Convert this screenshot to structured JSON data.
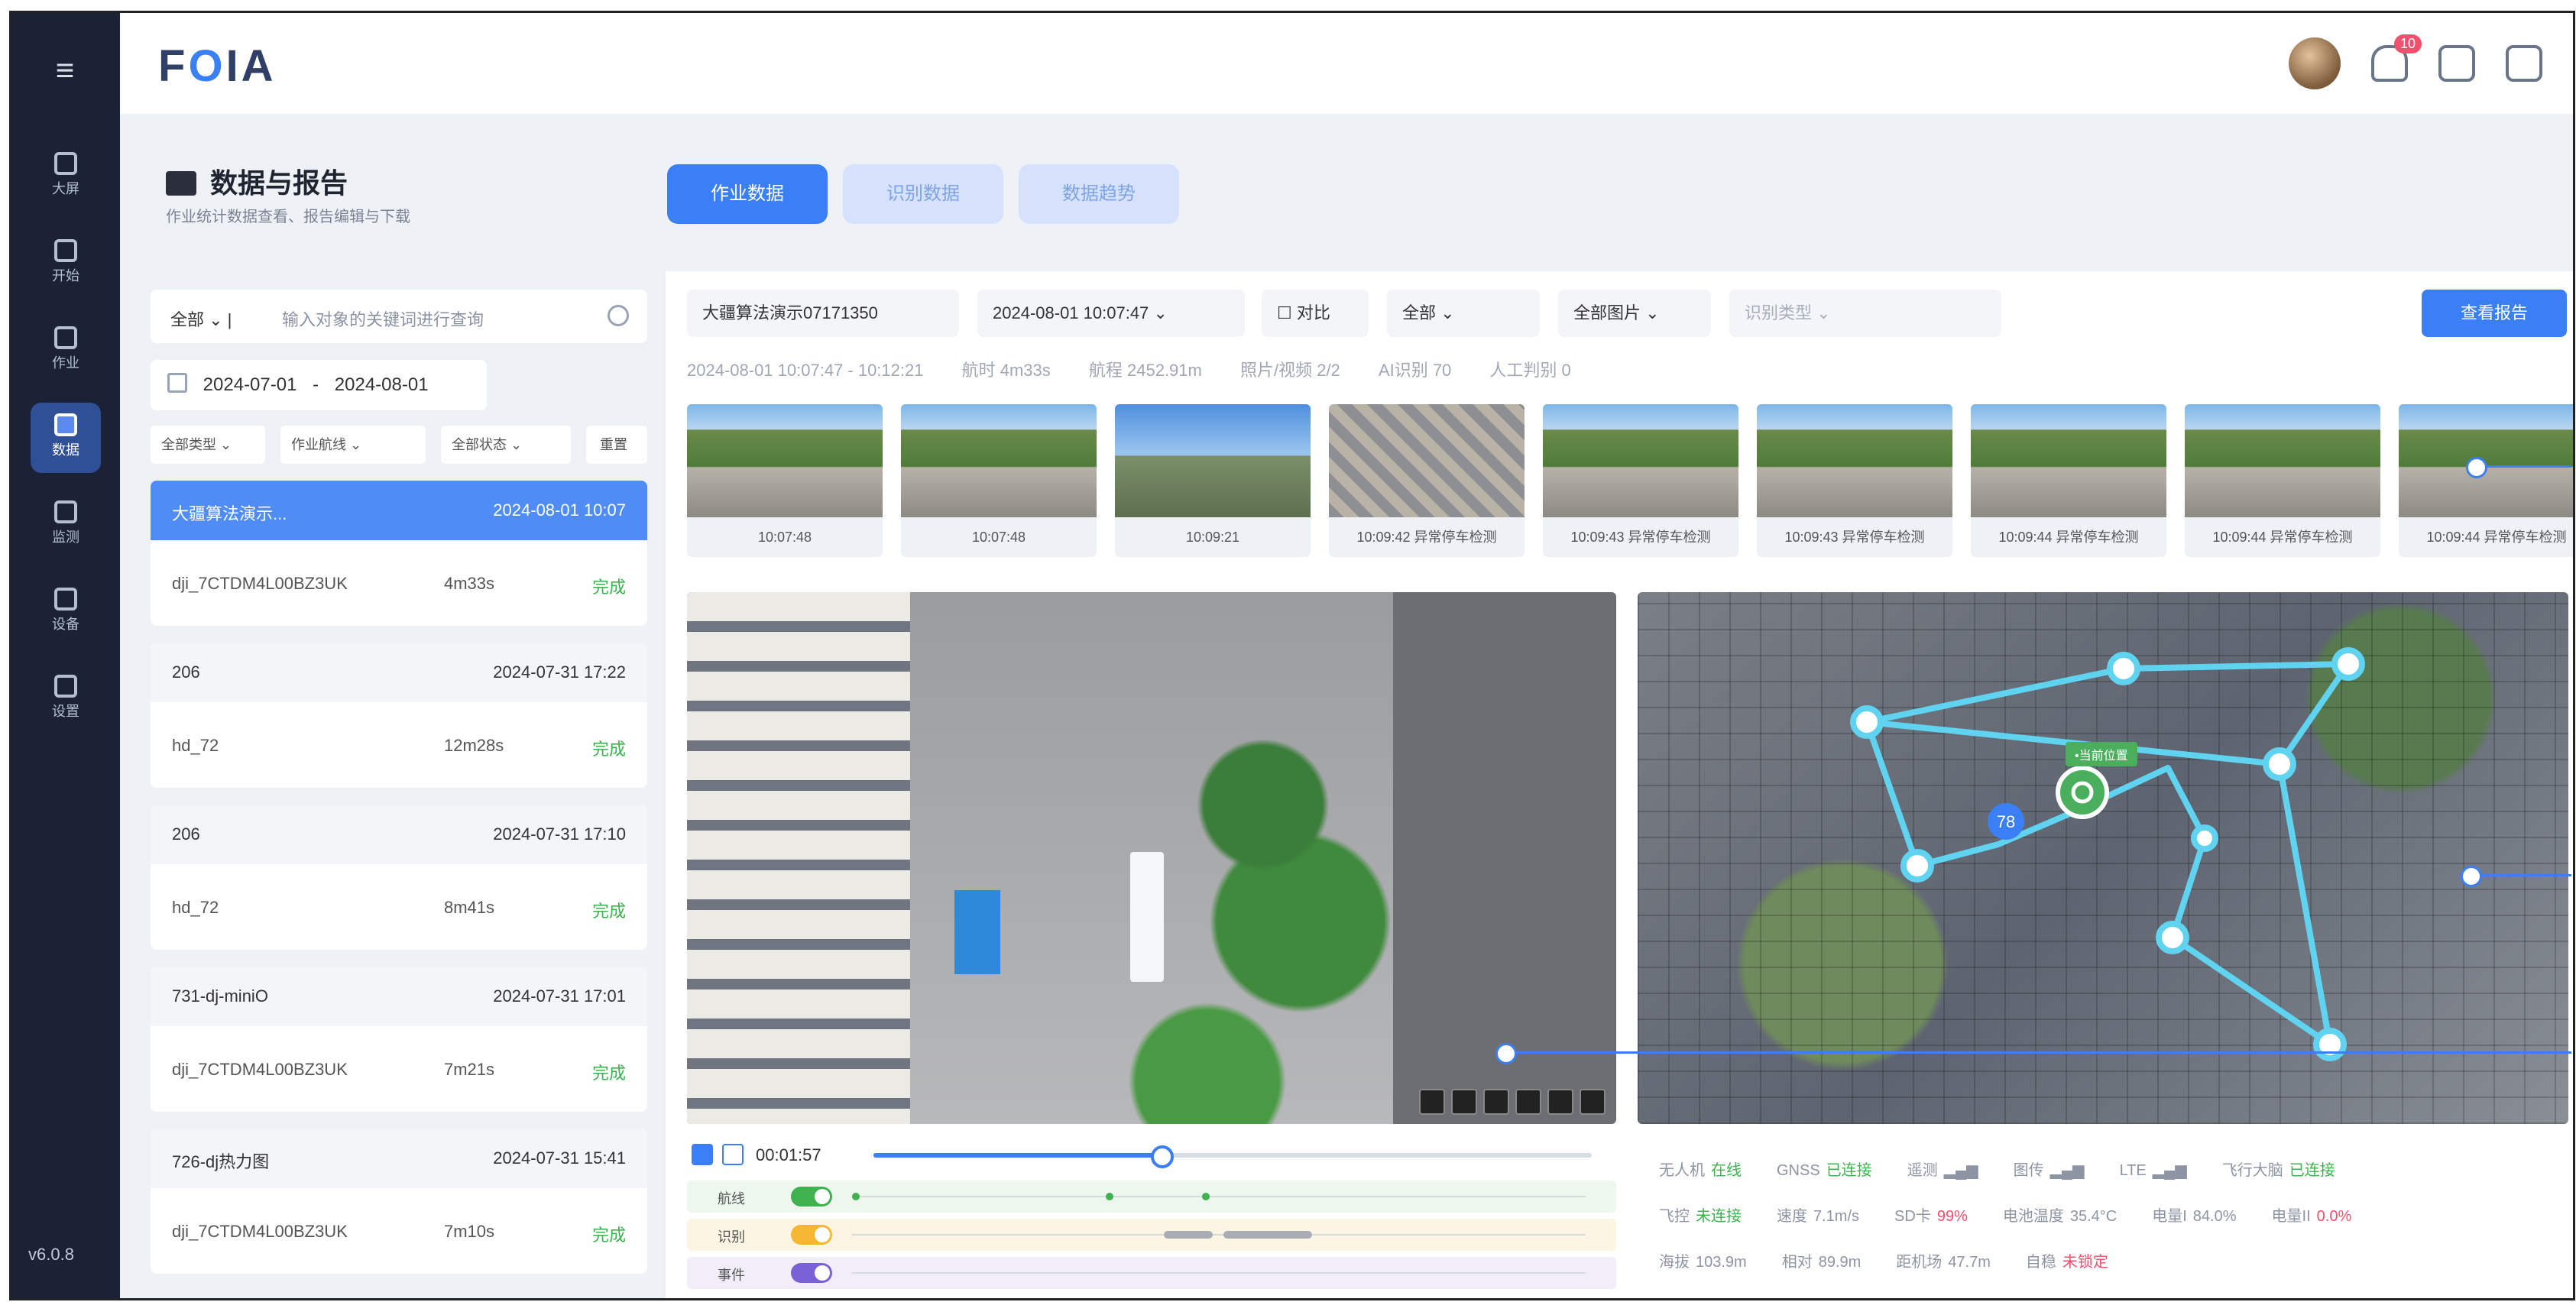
{
  "app": {
    "logo": "FOIA",
    "version": "v6.0.8",
    "notification_count": "10"
  },
  "rail": {
    "items": [
      {
        "label": "大屏",
        "icon": "monitor-icon"
      },
      {
        "label": "开始",
        "icon": "dashboard-icon"
      },
      {
        "label": "作业",
        "icon": "task-icon"
      },
      {
        "label": "数据",
        "icon": "chart-icon",
        "active": true
      },
      {
        "label": "监测",
        "icon": "eye-icon"
      },
      {
        "label": "设备",
        "icon": "device-icon"
      },
      {
        "label": "设置",
        "icon": "gear-icon"
      }
    ]
  },
  "header": {
    "title": "数据与报告",
    "subtitle": "作业统计数据查看、报告编辑与下载",
    "tabs": [
      "作业数据",
      "识别数据",
      "数据趋势"
    ]
  },
  "left": {
    "search": {
      "scope": "全部",
      "placeholder": "输入对象的关键词进行查询"
    },
    "date_range": {
      "start": "2024-07-01",
      "sep": "-",
      "end": "2024-08-01"
    },
    "filters": [
      "全部类型",
      "作业航线",
      "全部状态",
      "重置"
    ],
    "items": [
      {
        "name": "大疆算法演示...",
        "time": "2024-08-01 10:07",
        "device": "dji_7CTDM4L00BZ3UK",
        "duration": "4m33s",
        "status": "完成"
      },
      {
        "name": "206",
        "time": "2024-07-31 17:22",
        "device": "hd_72",
        "duration": "12m28s",
        "status": "完成"
      },
      {
        "name": "206",
        "time": "2024-07-31 17:10",
        "device": "hd_72",
        "duration": "8m41s",
        "status": "完成"
      },
      {
        "name": "731-dj-miniO",
        "time": "2024-07-31 17:01",
        "device": "dji_7CTDM4L00BZ3UK",
        "duration": "7m21s",
        "status": "完成"
      },
      {
        "name": "726-dj热力图",
        "time": "2024-07-31 15:41",
        "device": "dji_7CTDM4L00BZ3UK",
        "duration": "7m10s",
        "status": "完成"
      }
    ]
  },
  "main": {
    "filters": {
      "task": "大疆算法演示07171350",
      "datetime": "2024-08-01 10:07:47",
      "compare": "对比",
      "all": "全部",
      "images": "全部图片",
      "recognition": "识别类型",
      "report_button": "查看报告"
    },
    "meta": {
      "range": "2024-08-01 10:07:47 - 10:12:21",
      "duration": "航时 4m33s",
      "distance": "航程 2452.91m",
      "photos": "照片/视频 2/2",
      "ai": "AI识别 70",
      "manual": "人工判别 0"
    },
    "thumbnails": [
      {
        "caption": "10:07:48",
        "kind": "street"
      },
      {
        "caption": "10:07:48",
        "kind": "street"
      },
      {
        "caption": "10:09:21",
        "kind": "sky"
      },
      {
        "caption": "10:09:42 异常停车检测",
        "kind": "town"
      },
      {
        "caption": "10:09:43 异常停车检测",
        "kind": "street"
      },
      {
        "caption": "10:09:43 异常停车检测",
        "kind": "street"
      },
      {
        "caption": "10:09:44 异常停车检测",
        "kind": "street"
      },
      {
        "caption": "10:09:44 异常停车检测",
        "kind": "street"
      },
      {
        "caption": "10:09:44 异常停车检测",
        "kind": "street"
      }
    ],
    "player": {
      "time": "00:01:57",
      "progress": 0.4,
      "lanes": [
        {
          "label": "航线",
          "color": "#3db24f",
          "enabled": true
        },
        {
          "label": "识别",
          "color": "#f5b731",
          "enabled": true
        },
        {
          "label": "事件",
          "color": "#7b61d6",
          "enabled": true
        }
      ]
    },
    "map": {
      "tag": "•当前位置",
      "marker": "78"
    },
    "status": {
      "row1": [
        {
          "label": "无人机",
          "value": "在线",
          "tone": "g"
        },
        {
          "label": "GNSS",
          "value": "已连接",
          "tone": "g"
        },
        {
          "label": "遥测",
          "value": "▂▄▆",
          "tone": ""
        },
        {
          "label": "图传",
          "value": "▂▄▆",
          "tone": ""
        },
        {
          "label": "LTE",
          "value": "▂▄▆",
          "tone": ""
        },
        {
          "label": "飞行大脑",
          "value": "已连接",
          "tone": "g"
        }
      ],
      "row2": [
        {
          "label": "飞控",
          "value": "未连接",
          "tone": "g"
        },
        {
          "label": "速度",
          "value": "7.1m/s",
          "tone": ""
        },
        {
          "label": "SD卡",
          "value": "99%",
          "tone": "r"
        },
        {
          "label": "电池温度",
          "value": "35.4°C",
          "tone": ""
        },
        {
          "label": "电量I",
          "value": "84.0%",
          "tone": ""
        },
        {
          "label": "电量II",
          "value": "0.0%",
          "tone": "r"
        }
      ],
      "row3": [
        {
          "label": "海拔",
          "value": "103.9m",
          "tone": ""
        },
        {
          "label": "相对",
          "value": "89.9m",
          "tone": ""
        },
        {
          "label": "距机场",
          "value": "47.7m",
          "tone": ""
        },
        {
          "label": "自稳",
          "value": "未锁定",
          "tone": "r"
        }
      ]
    }
  }
}
